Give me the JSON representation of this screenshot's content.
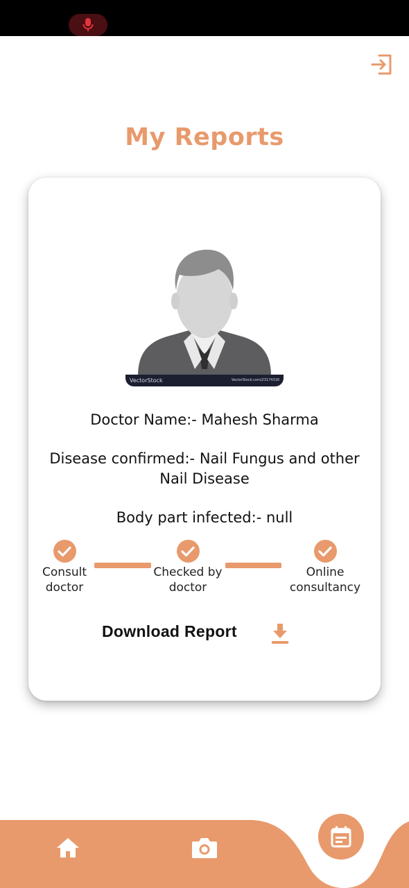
{
  "status_bar": {
    "mic_icon": "microphone-icon"
  },
  "header": {
    "logout_icon": "logout-icon",
    "title": "My Reports"
  },
  "report": {
    "avatar_watermark_left": "VectorStock",
    "avatar_watermark_right": "VectorStock.com/23174318",
    "doctor_name": "Doctor Name:- Mahesh Sharma",
    "disease": "Disease confirmed:- Nail Fungus and other Nail Disease",
    "body_part": "Body part infected:- null",
    "steps": [
      {
        "label": "Consult doctor",
        "icon": "check-icon"
      },
      {
        "label": "Checked by doctor",
        "icon": "check-icon"
      },
      {
        "label": "Online consultancy",
        "icon": "check-icon"
      }
    ],
    "download_label": "Download Report",
    "download_icon": "download-icon"
  },
  "bottom_nav": {
    "items": [
      {
        "name": "home",
        "icon": "home-icon"
      },
      {
        "name": "camera",
        "icon": "camera-icon"
      },
      {
        "name": "reports",
        "icon": "calendar-icon"
      }
    ]
  },
  "colors": {
    "accent": "#e89a6c",
    "mic_bg": "#4a0f12",
    "mic_red": "#e5343a"
  }
}
